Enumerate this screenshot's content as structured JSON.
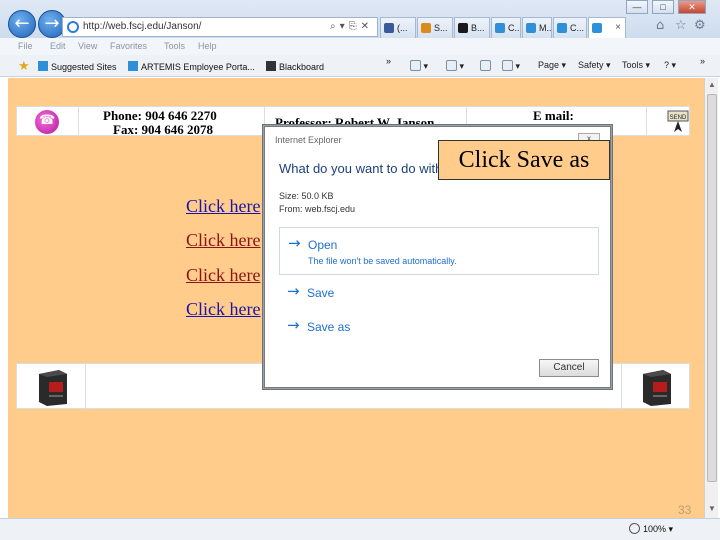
{
  "browser": {
    "url": "http://web.fscj.edu/Janson/",
    "tabs": [
      {
        "label": "(...",
        "icon_color": "#3b5998"
      },
      {
        "label": "S...",
        "icon_color": "#d98c1b"
      },
      {
        "label": "B...",
        "icon_color": "#1a1a1a"
      },
      {
        "label": "C...",
        "icon_color": "#2f8fd8"
      },
      {
        "label": "M...",
        "icon_color": "#2f8fd8"
      },
      {
        "label": "C...",
        "icon_color": "#2f8fd8"
      }
    ],
    "active_tab_close": "×",
    "menu": [
      "File",
      "Edit",
      "View",
      "Favorites",
      "Tools",
      "Help"
    ],
    "favorites": [
      {
        "label": "Suggested Sites",
        "icon_color": "#2f8fd8"
      },
      {
        "label": "ARTEMIS Employee Porta...",
        "icon_color": "#2f8fd8"
      },
      {
        "label": "Blackboard",
        "icon_color": "#333333"
      }
    ],
    "favbar_overflow": "»",
    "toolbar": {
      "page": "Page",
      "safety": "Safety",
      "tools": "Tools",
      "help_glyph": "?"
    },
    "zoom": "100%"
  },
  "page": {
    "background": "#ffcc8c",
    "contact": {
      "phone": "Phone:  904 646 2270",
      "fax": "Fax:  904 646 2078",
      "professor": "Professor: Robert W. Janson",
      "email_label": "E mail:"
    },
    "links": [
      {
        "label": "Click here",
        "visited": false
      },
      {
        "label": "Click here",
        "visited": true
      },
      {
        "label": "Click here",
        "visited": true
      },
      {
        "label": "Click here",
        "visited": false
      }
    ],
    "page_number": "33"
  },
  "dialog": {
    "title": "Internet Explorer",
    "close": "x",
    "question": "What do you want to do with",
    "size": "Size: 50.0 KB",
    "from": "From: web.fscj.edu",
    "options": [
      {
        "label": "Open",
        "sub": "The file won't be saved automatically."
      },
      {
        "label": "Save",
        "sub": ""
      },
      {
        "label": "Save as",
        "sub": ""
      }
    ],
    "cancel": "Cancel"
  },
  "callout": "Click Save as"
}
